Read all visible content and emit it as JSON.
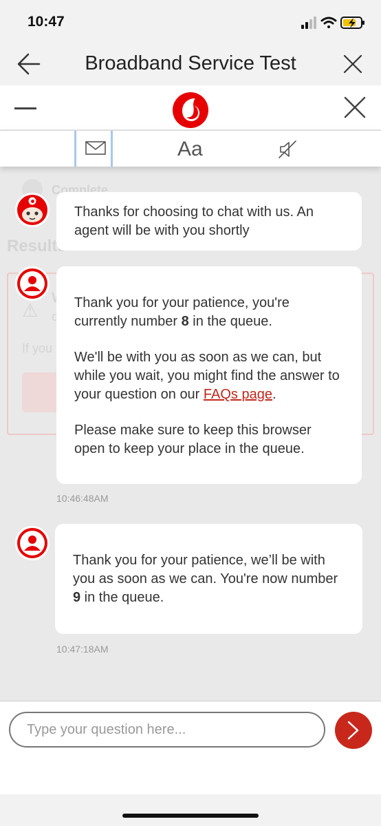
{
  "status_bar": {
    "time": "10:47"
  },
  "nav": {
    "title": "Broadband Service Test"
  },
  "toolbar": {
    "font_label": "Aa"
  },
  "background": {
    "complete_label": "Complete",
    "results_heading": "Results",
    "warning_initial": "W",
    "warning_initial_2": "c",
    "if_you_text": "If you"
  },
  "messages": [
    {
      "sender": "bot",
      "paragraphs": [
        "Thanks for choosing to chat with us. An agent will be with you shortly"
      ]
    },
    {
      "sender": "agent",
      "p1_before": "Thank you for your patience, you're currently number ",
      "p1_number": "8",
      "p1_after": " in the queue.",
      "p2_before": "We'll be with you as soon as we can, but while you wait, you might find the answer to your question on our ",
      "p2_link": "FAQs page",
      "p2_after": ".",
      "p3": "Please make sure to keep this browser open to keep your place in the queue.",
      "timestamp": "10:46:48AM"
    },
    {
      "sender": "agent",
      "p1_before": "Thank you for your patience, we’ll be with you as soon as we can. You're now number ",
      "p1_number": "9",
      "p1_after": " in the queue.",
      "timestamp": "10:47:18AM"
    }
  ],
  "composer": {
    "placeholder": "Type your question here..."
  },
  "colors": {
    "brand_red": "#e60000",
    "send_button": "#c8281c",
    "link": "#c0271c"
  },
  "icons": [
    "back-arrow-icon",
    "close-icon",
    "minimize-icon",
    "vodafone-logo",
    "email-icon",
    "mute-speaker-icon",
    "send-chevron-icon",
    "bot-avatar",
    "agent-avatar-icon"
  ]
}
